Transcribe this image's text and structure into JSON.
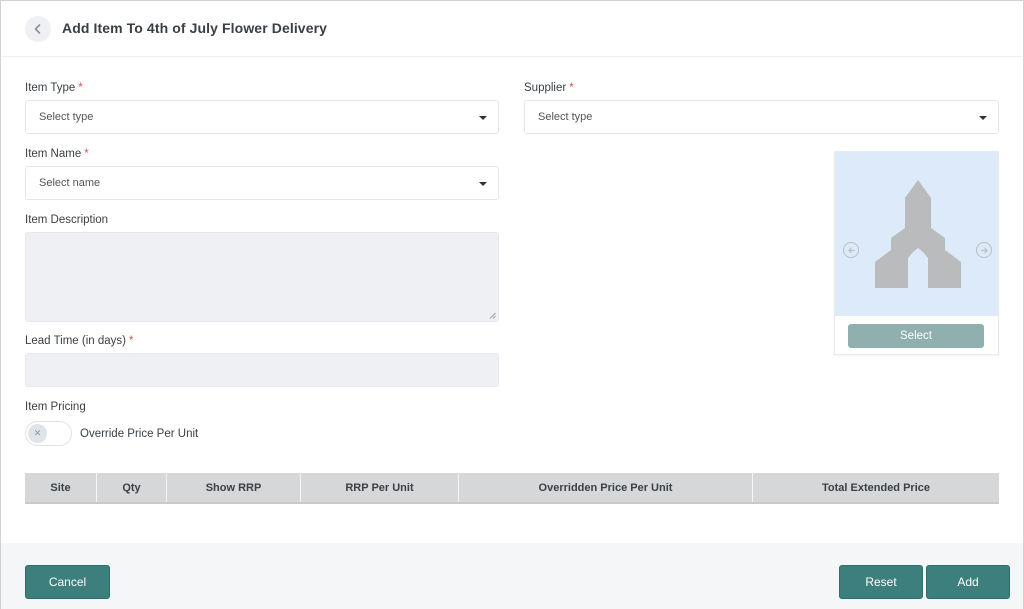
{
  "header": {
    "title": "Add Item To 4th of July Flower Delivery",
    "back_icon": "chevron-left-icon"
  },
  "form": {
    "item_type": {
      "label": "Item Type",
      "required": "*",
      "placeholder": "Select type"
    },
    "supplier": {
      "label": "Supplier",
      "required": "*",
      "placeholder": "Select type"
    },
    "item_name": {
      "label": "Item Name",
      "required": "*",
      "placeholder": "Select name"
    },
    "item_description": {
      "label": "Item Description",
      "value": ""
    },
    "lead_time": {
      "label": "Lead Time (in days)",
      "required": "*",
      "value": ""
    },
    "item_pricing": {
      "label": "Item Pricing",
      "toggle_label": "Override Price Per Unit",
      "toggle_on": false
    }
  },
  "pricing_table": {
    "columns": [
      "Site",
      "Qty",
      "Show RRP",
      "RRP Per Unit",
      "Overridden Price Per Unit",
      "Total Extended Price"
    ],
    "rows": []
  },
  "image_card": {
    "prev_icon": "arrow-left-circle-icon",
    "next_icon": "arrow-right-circle-icon",
    "image_icon": "church-icon",
    "select_label": "Select"
  },
  "footer": {
    "cancel_label": "Cancel",
    "reset_label": "Reset",
    "add_label": "Add"
  },
  "colors": {
    "primary": "#3d7f7c",
    "select_button": "#8fb0ae",
    "required": "#d9534f",
    "image_bg": "#ddeaf9"
  }
}
